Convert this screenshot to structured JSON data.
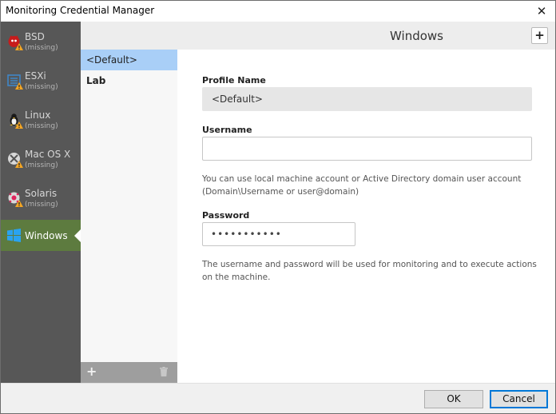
{
  "window": {
    "title": "Monitoring Credential Manager"
  },
  "os_list": [
    {
      "name": "BSD",
      "status": "(missing)",
      "icon": "bsd-daemon-icon",
      "warning": true
    },
    {
      "name": "ESXi",
      "status": "(missing)",
      "icon": "esxi-icon",
      "warning": true
    },
    {
      "name": "Linux",
      "status": "(missing)",
      "icon": "linux-tux-icon",
      "warning": true
    },
    {
      "name": "Mac OS X",
      "status": "(missing)",
      "icon": "apple-icon",
      "warning": true
    },
    {
      "name": "Solaris",
      "status": "(missing)",
      "icon": "solaris-icon",
      "warning": true
    },
    {
      "name": "Windows",
      "status": "",
      "icon": "windows-logo-icon",
      "warning": false,
      "active": true
    }
  ],
  "profiles": [
    {
      "label": "<Default>",
      "selected": true
    },
    {
      "label": "Lab",
      "selected": false
    }
  ],
  "content": {
    "title": "Windows",
    "profile_name_label": "Profile Name",
    "profile_name_value": "<Default>",
    "username_label": "Username",
    "username_value": "",
    "username_help": "You can use local machine account or Active Directory domain user account (Domain\\Username or user@domain)",
    "password_label": "Password",
    "password_value": "•••••••••••",
    "password_help": "The username and password will be used for monitoring and to execute actions on the machine."
  },
  "buttons": {
    "ok": "OK",
    "cancel": "Cancel"
  },
  "colors": {
    "sidebar_bg": "#575757",
    "active_os_bg": "#5d7b3f",
    "selected_profile_bg": "#a9cff7",
    "warning": "#f5a623"
  }
}
